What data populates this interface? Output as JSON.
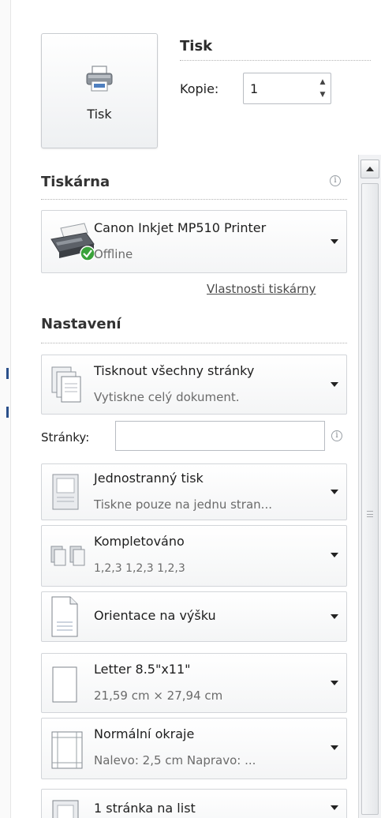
{
  "print_button": {
    "label": "Tisk",
    "icon": "printer-icon"
  },
  "print_section": {
    "title": "Tisk",
    "copies_label": "Kopie:",
    "copies_value": "1"
  },
  "printer_section": {
    "title": "Tiskárna",
    "printer_name": "Canon Inkjet MP510 Printer",
    "printer_status": "Offline",
    "properties_link": "Vlastnosti tiskárny"
  },
  "settings_section": {
    "title": "Nastavení",
    "pages_label": "Stránky:",
    "pages_value": "",
    "items": [
      {
        "line1": "Tisknout všechny stránky",
        "line2": "Vytiskne celý dokument.",
        "icon": "pages-stack-icon"
      },
      {
        "line1": "Jednostranný tisk",
        "line2": "Tiskne pouze na jednu stran...",
        "icon": "single-sided-icon"
      },
      {
        "line1": "Kompletováno",
        "line2": "1,2,3    1,2,3    1,2,3",
        "icon": "collated-icon"
      },
      {
        "line1": "Orientace na výšku",
        "line2": "",
        "icon": "portrait-page-icon"
      },
      {
        "line1": "Letter 8.5\"x11\"",
        "line2": "21,59 cm × 27,94 cm",
        "icon": "paper-size-icon"
      },
      {
        "line1": "Normální okraje",
        "line2": "Nalevo:  2,5 cm   Napravo:  ...",
        "icon": "margins-icon"
      },
      {
        "line1": "1 stránka na list",
        "line2": "",
        "icon": "pages-per-sheet-icon"
      }
    ]
  },
  "colors": {
    "accent": "#2a4f8a",
    "status_ok": "#3aa23a",
    "border": "#d2d5d9"
  }
}
